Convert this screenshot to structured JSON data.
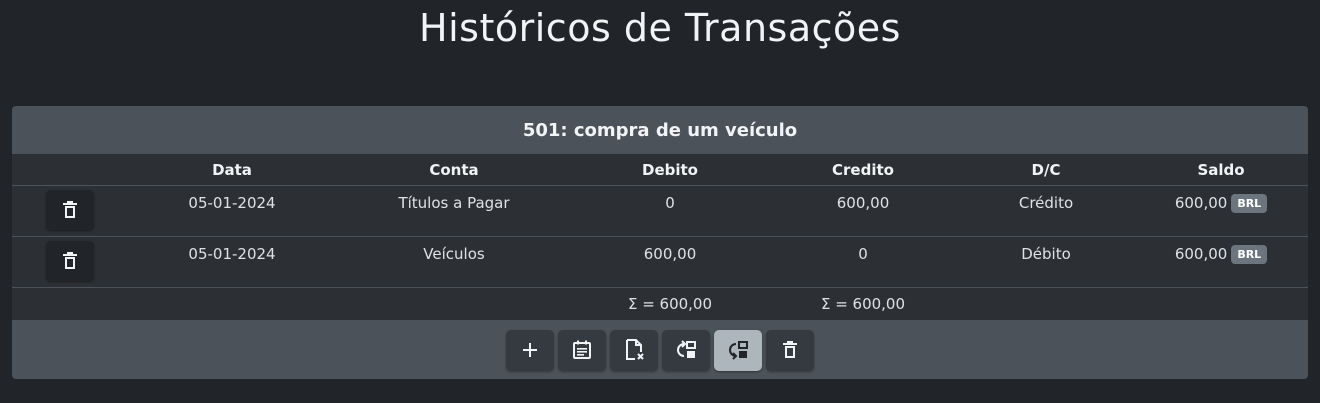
{
  "title": "Históricos de Transações",
  "card": {
    "header": "501: compra de um veículo",
    "columns": {
      "data": "Data",
      "conta": "Conta",
      "debito": "Debito",
      "credito": "Credito",
      "dc": "D/C",
      "saldo": "Saldo"
    },
    "rows": [
      {
        "data": "05-01-2024",
        "conta": "Títulos a Pagar",
        "debito": "0",
        "credito": "600,00",
        "dc": "Crédito",
        "saldo": "600,00",
        "currency": "BRL"
      },
      {
        "data": "05-01-2024",
        "conta": "Veículos",
        "debito": "600,00",
        "credito": "0",
        "dc": "Débito",
        "saldo": "600,00",
        "currency": "BRL"
      }
    ],
    "sum": {
      "debito": "Σ = 600,00",
      "credito": "Σ = 600,00"
    }
  },
  "toolbar": {
    "buttons": [
      {
        "icon": "plus-icon"
      },
      {
        "icon": "calendar-list-icon"
      },
      {
        "icon": "file-cancel-icon"
      },
      {
        "icon": "swap-left-icon"
      },
      {
        "icon": "swap-right-icon",
        "active": true
      },
      {
        "icon": "trash-icon"
      }
    ]
  },
  "colors": {
    "background": "#212529",
    "card": "#2c3034",
    "header": "#4b5259",
    "active_button": "#adb5bd",
    "badge": "#6c757d"
  }
}
